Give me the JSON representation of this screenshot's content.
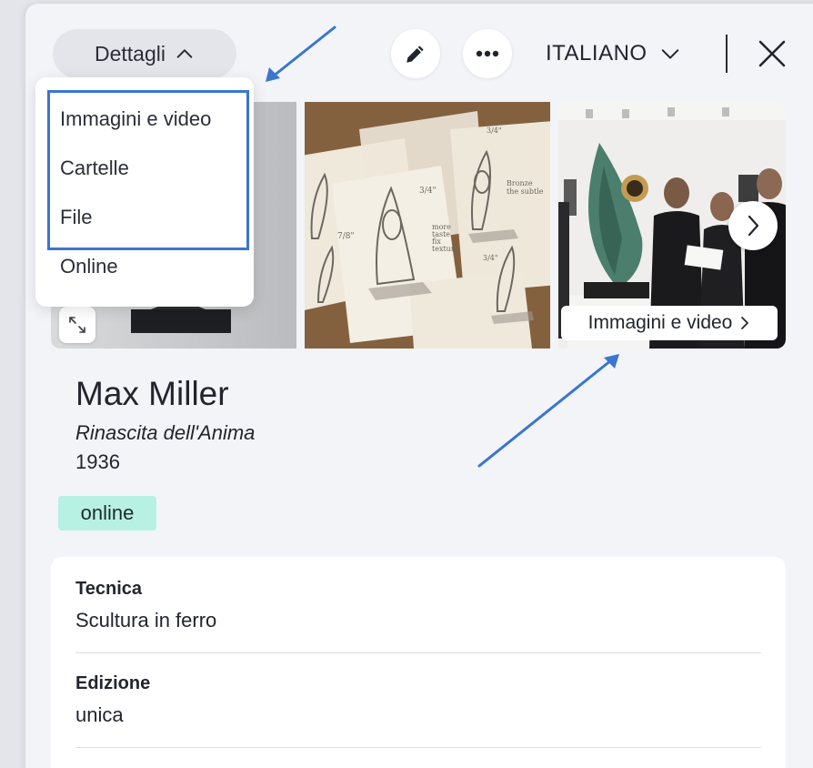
{
  "header": {
    "details_label": "Dettagli",
    "language_label": "ITALIANO"
  },
  "dropdown": {
    "items": [
      {
        "label": "Immagini e video"
      },
      {
        "label": "Cartelle"
      },
      {
        "label": "File"
      },
      {
        "label": "Online"
      }
    ]
  },
  "gallery": {
    "media_link_label": "Immagini e video",
    "annotations": {
      "sketch_notes": [
        "3/4\"",
        "7/8\"",
        "Bronze",
        "the subtle",
        "more",
        "taste",
        "fix",
        "texture",
        "3/4\"",
        "3/4\""
      ]
    }
  },
  "artwork": {
    "artist": "Max Miller",
    "title": "Rinascita dell'Anima",
    "year": "1936",
    "status_badge": "online"
  },
  "details": {
    "fields": [
      {
        "label": "Tecnica",
        "value": "Scultura in ferro"
      },
      {
        "label": "Edizione",
        "value": "unica"
      }
    ]
  },
  "colors": {
    "panel_bg": "#f3f4f8",
    "badge_bg": "#b7f1e3",
    "annotation_blue": "#3a76cf"
  }
}
